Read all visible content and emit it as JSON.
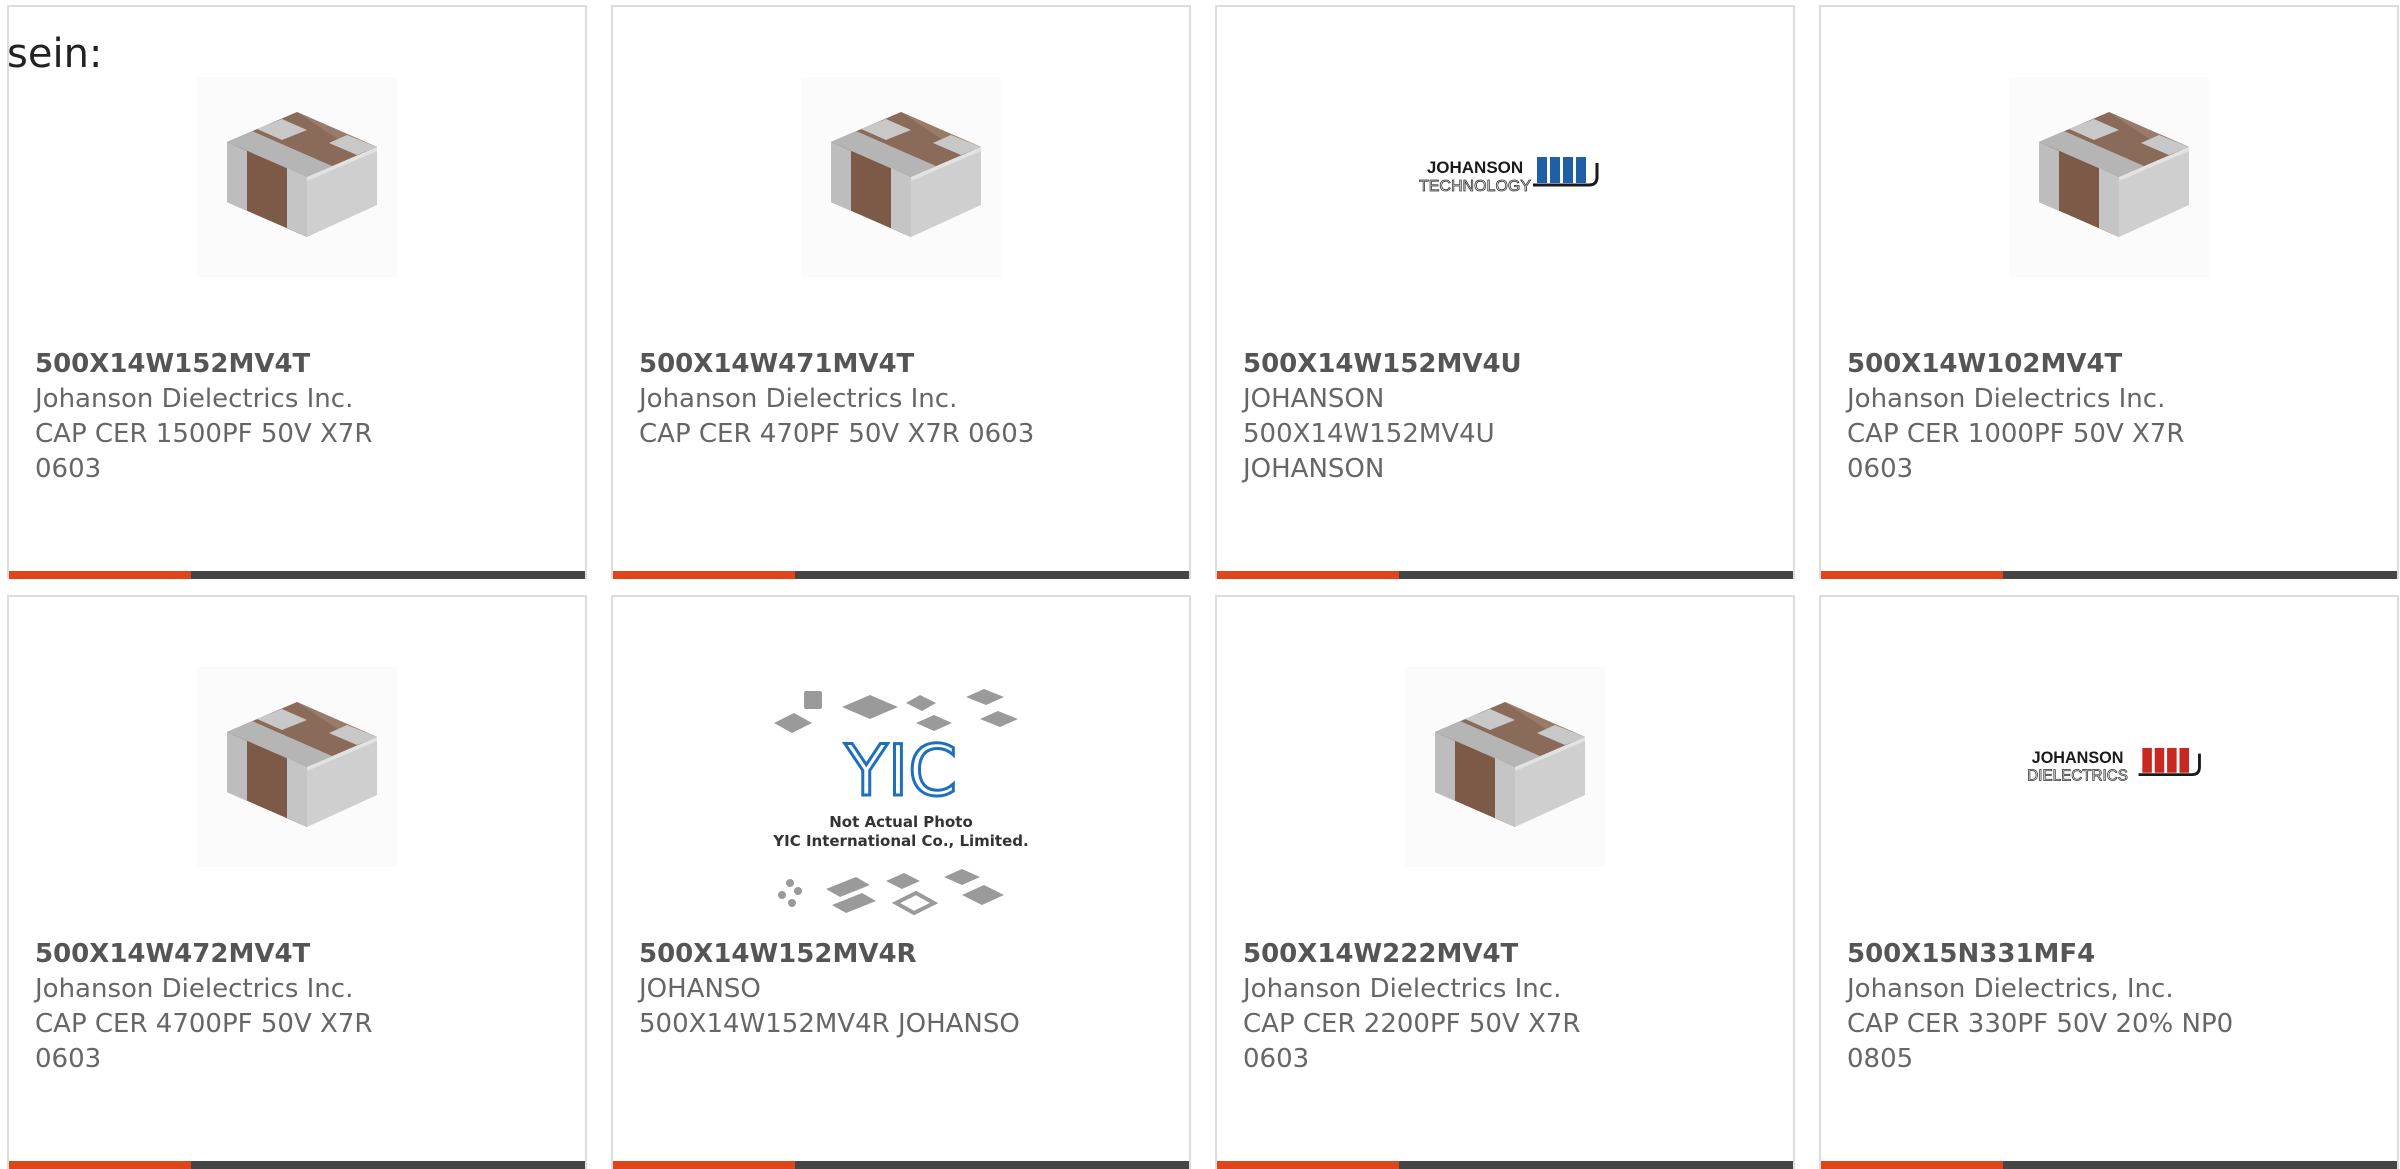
{
  "lead_text": "sein:",
  "colors": {
    "accent": "#e0441b",
    "bar": "#454545",
    "border": "#dcdcdc",
    "text": "#666666"
  },
  "products": [
    {
      "part": "500X14W152MV4T",
      "manufacturer": "Johanson Dielectrics Inc.",
      "description": "CAP CER 1500PF 50V X7R 0603",
      "image": "chip-capacitor-icon"
    },
    {
      "part": "500X14W471MV4T",
      "manufacturer": "Johanson Dielectrics Inc.",
      "description": "CAP CER 470PF 50V X7R 0603",
      "image": "chip-capacitor-icon"
    },
    {
      "part": "500X14W152MV4U",
      "manufacturer": "JOHANSON",
      "description": "500X14W152MV4U JOHANSON",
      "image": "johanson-technology-logo",
      "logo_line1": "JOHANSON",
      "logo_line2": "TECHNOLOGY"
    },
    {
      "part": "500X14W102MV4T",
      "manufacturer": "Johanson Dielectrics Inc.",
      "description": "CAP CER 1000PF 50V X7R 0603",
      "image": "chip-capacitor-icon"
    },
    {
      "part": "500X14W472MV4T",
      "manufacturer": "Johanson Dielectrics Inc.",
      "description": "CAP CER 4700PF 50V X7R 0603",
      "image": "chip-capacitor-icon"
    },
    {
      "part": "500X14W152MV4R",
      "manufacturer": "JOHANSO",
      "description": "500X14W152MV4R JOHANSO",
      "image": "yic-placeholder-image",
      "placeholder_logo": "YIC",
      "placeholder_line1": "Not Actual Photo",
      "placeholder_line2": "YIC International Co., Limited."
    },
    {
      "part": "500X14W222MV4T",
      "manufacturer": "Johanson Dielectrics Inc.",
      "description": "CAP CER 2200PF 50V X7R 0603",
      "image": "chip-capacitor-icon"
    },
    {
      "part": "500X15N331MF4",
      "manufacturer": "Johanson Dielectrics, Inc.",
      "description": "CAP CER 330PF 50V 20% NP0 0805",
      "image": "johanson-dielectrics-logo",
      "logo_line1": "JOHANSON",
      "logo_line2": "DIELECTRICS"
    }
  ]
}
